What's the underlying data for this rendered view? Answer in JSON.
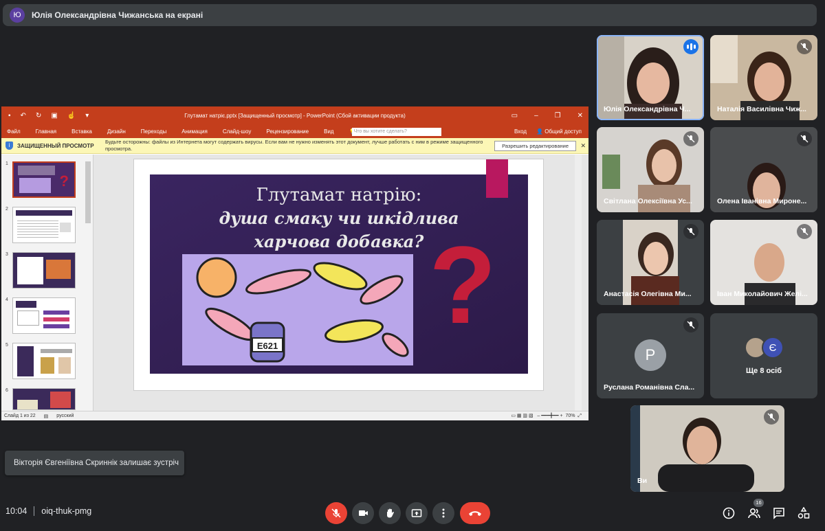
{
  "presenter": {
    "avatar": "Ю",
    "text": "Юлія Олександрівна Чижанська на екрані"
  },
  "ppt": {
    "title": "Глутамат натріє.pptx [Защищенный просмотр] - PowerPoint (Сбой активации продукта)",
    "menu": [
      "Файл",
      "Главная",
      "Вставка",
      "Дизайн",
      "Переходы",
      "Анимация",
      "Слайд-шоу",
      "Рецензирование",
      "Вид"
    ],
    "tellme_placeholder": "Что вы хотите сделать?",
    "signin": "Вход",
    "share": "Общий доступ",
    "protected_label": "ЗАЩИЩЕННЫЙ ПРОСМОТР",
    "protected_msg": "Будьте осторожны: файлы из Интернета могут содержать вирусы. Если вам не нужно изменять этот документ, лучше работать с ним в режиме защищенного просмотра.",
    "enable_edit": "Разрешить редактирование",
    "thumb_numbers": [
      "1",
      "2",
      "3",
      "4",
      "5",
      "6"
    ],
    "slide": {
      "title_line1": "Глутамат натрію:",
      "title_line2": "душа смаку чи шкідлива",
      "title_line3": "харчова добавка?",
      "jar_label": "E621",
      "question_mark": "?"
    },
    "status_slide": "Слайд 1 из 22",
    "status_lang": "русский",
    "zoom": "70%"
  },
  "tiles": [
    {
      "name": "Юлія Олександрівна Ч..."
    },
    {
      "name": "Наталія Василівна Чиж..."
    },
    {
      "name": "Світлана Олексіївна Ус..."
    },
    {
      "name": "Олена Іванівна Мироне..."
    },
    {
      "name": "Анастасія Олегівна Ми..."
    },
    {
      "name": "Іван Миколайович Желі..."
    },
    {
      "name": "Руслана Романівна Сла...",
      "avatar": "Р"
    },
    {
      "name": "Ще 8 осіб",
      "avatar": "Є"
    },
    {
      "name": "Ви"
    }
  ],
  "toast": "Вікторія Євгеніївна Скриннік залишає зустріч",
  "bottom": {
    "time": "10:04",
    "meeting_code": "oiq-thuk-pmg",
    "participants_count": "16"
  },
  "colors": {
    "ppt_accent": "#c43e1c",
    "hangup": "#ea4335",
    "active_outline": "#8ab4f8"
  }
}
